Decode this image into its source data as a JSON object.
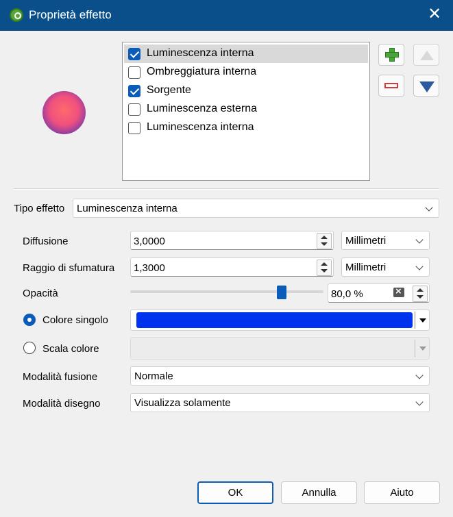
{
  "window": {
    "title": "Proprietà effetto"
  },
  "effects": [
    {
      "label": "Luminescenza interna",
      "checked": true,
      "selected": true
    },
    {
      "label": "Ombreggiatura interna",
      "checked": false,
      "selected": false
    },
    {
      "label": "Sorgente",
      "checked": true,
      "selected": false
    },
    {
      "label": "Luminescenza esterna",
      "checked": false,
      "selected": false
    },
    {
      "label": "Luminescenza interna",
      "checked": false,
      "selected": false
    }
  ],
  "effect_type": {
    "label": "Tipo effetto",
    "value": "Luminescenza interna"
  },
  "diffusion": {
    "label": "Diffusione",
    "value": "3,0000",
    "unit": "Millimetri"
  },
  "blur": {
    "label": "Raggio di sfumatura",
    "value": "1,3000",
    "unit": "Millimetri"
  },
  "opacity": {
    "label": "Opacità",
    "value": "80,0 %",
    "level": 0.8
  },
  "color_mode": {
    "single": {
      "label": "Colore singolo",
      "selected": true,
      "color": "#0033ee"
    },
    "ramp": {
      "label": "Scala colore",
      "selected": false
    }
  },
  "blend_mode": {
    "label": "Modalità fusione",
    "value": "Normale"
  },
  "draw_mode": {
    "label": "Modalità disegno",
    "value": "Visualizza solamente"
  },
  "buttons": {
    "ok": "OK",
    "cancel": "Annulla",
    "help": "Aiuto"
  },
  "icons": [
    "qgis-logo-icon",
    "close-icon",
    "add-effect-icon",
    "remove-effect-icon",
    "move-up-icon",
    "move-down-icon",
    "clear-icon",
    "chevron-down-icon"
  ]
}
